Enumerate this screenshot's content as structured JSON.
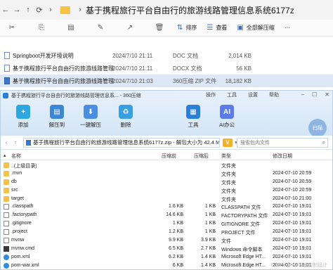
{
  "explorer": {
    "title": "基于携程旅行平台自由行的旅游线路管理信息系统6177z",
    "toolbar": {
      "sort": "排序",
      "view": "查看",
      "extract_all": "全部解压缩"
    },
    "files": [
      {
        "name": "Springboot开发环境说明",
        "date": "2024/7/10 21:11",
        "type": "DOC 文档",
        "size": "2,014 KB",
        "kind": "doc"
      },
      {
        "name": "基于携程旅行平台自由行的旅游线路管理...",
        "date": "2024/7/10 21:11",
        "type": "DOCX 文档",
        "size": "56 KB",
        "kind": "doc"
      },
      {
        "name": "基于携程旅行平台自由行的旅游线路管理...",
        "date": "2024/7/10 21:03",
        "type": "360压缩 ZIP 文件",
        "size": "18,182 KB",
        "kind": "zip"
      }
    ]
  },
  "zip": {
    "caption": "基于携程旅行平台自由行的旅游线路管理信息系... - 360压缩",
    "menu": [
      "操作",
      "工具",
      "设置",
      "帮助"
    ],
    "tools": [
      "添加",
      "解压到",
      "一键解压",
      "删除",
      "工具",
      "AI办公"
    ],
    "scan": "扫描",
    "path": "基于携程旅行平台自由行的旅游线路管理信息系统6177z.zip - 解包大小为 42.4 MB",
    "search_placeholder": "搜索包内文件",
    "headers": {
      "name": "名称",
      "compressed": "压缩前",
      "original": "压缩后",
      "type": "类型",
      "modified": "修改日期"
    },
    "rows": [
      {
        "name": "..(上级目录)",
        "comp": "",
        "orig": "",
        "type": "文件夹",
        "date": "",
        "icon": "folder"
      },
      {
        "name": ".mvn",
        "comp": "",
        "orig": "",
        "type": "文件夹",
        "date": "2024-07-10 20:59",
        "icon": "folder"
      },
      {
        "name": "db",
        "comp": "",
        "orig": "",
        "type": "文件夹",
        "date": "2024-07-10 20:59",
        "icon": "folder"
      },
      {
        "name": "src",
        "comp": "",
        "orig": "",
        "type": "文件夹",
        "date": "2024-07-10 20:59",
        "icon": "folder"
      },
      {
        "name": "target",
        "comp": "",
        "orig": "",
        "type": "文件夹",
        "date": "2024-07-10 21:00",
        "icon": "folder"
      },
      {
        "name": ".classpath",
        "comp": "1.6 KB",
        "orig": "1 KB",
        "type": "CLASSPATH 文件",
        "date": "2024-07-10 19:01",
        "icon": "file"
      },
      {
        "name": ".factorypath",
        "comp": "14.6 KB",
        "orig": "1 KB",
        "type": "FACTORYPATH 文件",
        "date": "2024-07-10 19:01",
        "icon": "file"
      },
      {
        "name": ".gitignore",
        "comp": "1 KB",
        "orig": "1 KB",
        "type": "GITIGNORE 文件",
        "date": "2024-07-10 19:01",
        "icon": "file"
      },
      {
        "name": ".project",
        "comp": "1.2 KB",
        "orig": "1 KB",
        "type": "PROJECT 文件",
        "date": "2024-07-10 19:01",
        "icon": "file"
      },
      {
        "name": "mvnw",
        "comp": "9.9 KB",
        "orig": "3.9 KB",
        "type": "文件",
        "date": "2024-07-10 19:01",
        "icon": "file"
      },
      {
        "name": "mvnw.cmd",
        "comp": "6.5 KB",
        "orig": "2.7 KB",
        "type": "Windows 命令脚本",
        "date": "2024-07-10 19:01",
        "icon": "cmd"
      },
      {
        "name": "pom.xml",
        "comp": "6.2 KB",
        "orig": "1.4 KB",
        "type": "Microsoft Edge HT...",
        "date": "2024-07-10 19:01",
        "icon": "edge"
      },
      {
        "name": "pom-war.xml",
        "comp": "6 KB",
        "orig": "1.4 KB",
        "type": "Microsoft Edge HT...",
        "date": "2024-07-10 19:01",
        "icon": "edge"
      }
    ]
  },
  "watermark": "CSDN @VX毕设定制设计",
  "colors": {
    "accent": "#2b7de0",
    "selection": "#dde8f6"
  }
}
